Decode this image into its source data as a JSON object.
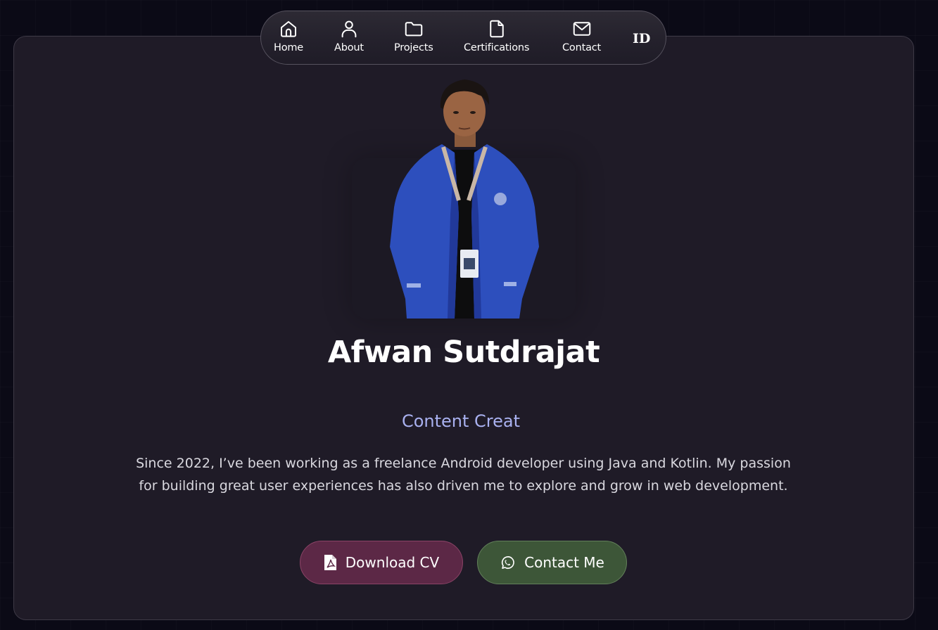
{
  "nav": {
    "items": [
      {
        "label": "Home",
        "icon": "home-icon"
      },
      {
        "label": "About",
        "icon": "user-icon"
      },
      {
        "label": "Projects",
        "icon": "folder-icon"
      },
      {
        "label": "Certifications",
        "icon": "file-icon"
      },
      {
        "label": "Contact",
        "icon": "mail-icon"
      }
    ],
    "language": "ID"
  },
  "hero": {
    "name": "Afwan Sutdrajat",
    "role": "Content Creat",
    "bio": "Since 2022, I’ve been working as a freelance Android developer using Java and Kotlin. My passion for building great user experiences has also driven me to explore and grow in web development.",
    "buttons": {
      "cv": {
        "label": "Download CV",
        "icon": "pdf-icon"
      },
      "contact": {
        "label": "Contact Me",
        "icon": "whatsapp-icon"
      }
    }
  },
  "colors": {
    "page_bg": "#0b0a16",
    "card_bg": "#1f1b27",
    "role_text": "#a9b1f0",
    "cv_button": "#5c2846",
    "contact_button": "#3d5638"
  }
}
